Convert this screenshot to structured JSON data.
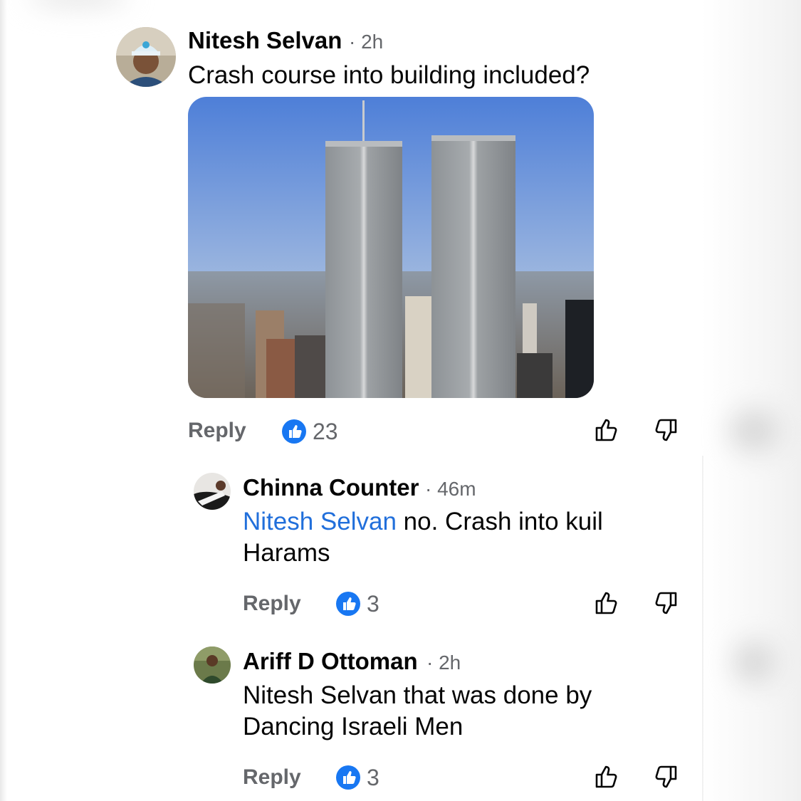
{
  "comments": [
    {
      "author": "Nitesh Selvan",
      "time": "· 2h",
      "text": "Crash course into building included?",
      "reply_label": "Reply",
      "like_count": "23",
      "avatar_icon": "user-avatar-icon"
    },
    {
      "author": "Chinna Counter",
      "time": "· 46m",
      "mention": "Nitesh Selvan",
      "text_line1": " no. Crash into kuil",
      "text_line2": "Harams",
      "reply_label": "Reply",
      "like_count": "3",
      "avatar_icon": "user-avatar-icon"
    },
    {
      "author": "Ariff D Ottoman",
      "time": "· 2h",
      "text_line1": "Nitesh Selvan that was done by",
      "text_line2": "Dancing Israeli Men",
      "reply_label": "Reply",
      "like_count": "3",
      "avatar_icon": "user-avatar-icon"
    }
  ],
  "colors": {
    "like_blue": "#1877f2",
    "mention_blue": "#216fdb",
    "secondary_text": "#65676b"
  },
  "icons": [
    "thumbs-up-icon",
    "thumbs-down-icon",
    "like-reaction-icon"
  ]
}
